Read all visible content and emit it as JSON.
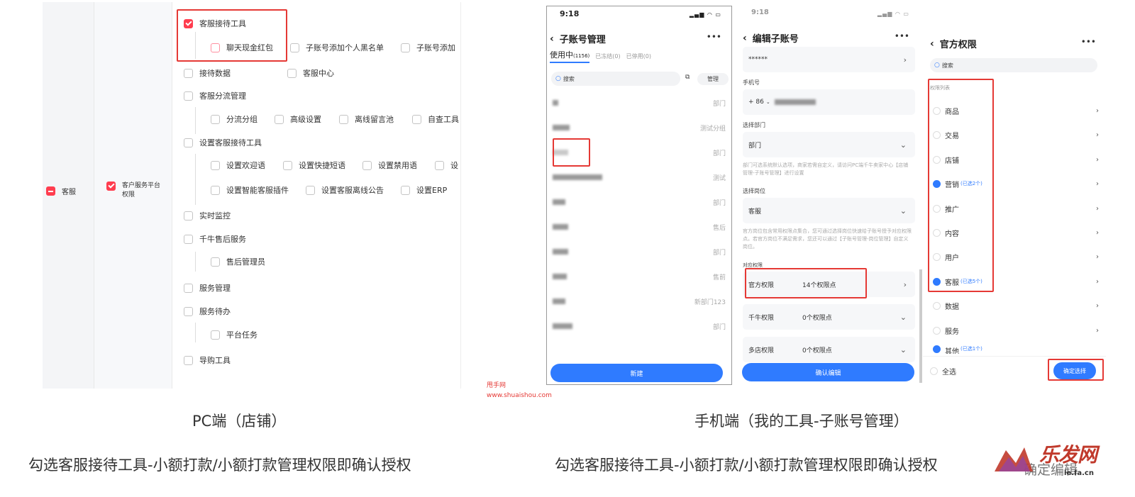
{
  "pc": {
    "level1": "客服",
    "level2": "客户服务平台权限",
    "items": {
      "kefu_tool": "客服接待工具",
      "cash_hongbao": "聊天现金红包",
      "sub_blacklist": "子账号添加个人黑名单",
      "sub_add": "子账号添加",
      "reception_data": "接待数据",
      "service_center": "客服中心",
      "diversion_mgmt": "客服分流管理",
      "diversion_group": "分流分组",
      "advanced_settings": "高级设置",
      "offline_msg": "离线留言池",
      "self_check": "自查工具",
      "set_tools": "设置客服接待工具",
      "welcome": "设置欢迎语",
      "quick_reply": "设置快捷短语",
      "forbidden_words": "设置禁用语",
      "set_more": "设",
      "plugin": "设置智能客服插件",
      "offline_notice": "设置客服离线公告",
      "erp": "设置ERP",
      "realtime": "实时监控",
      "qianniu_after": "千牛售后服务",
      "after_admin": "售后管理员",
      "service_mgmt": "服务管理",
      "service_todo": "服务待办",
      "platform_task": "平台任务",
      "guide_tool": "导购工具"
    },
    "caption": "PC端（店铺）",
    "instruction": "勾选客服接待工具-小额打款/小额打款管理权限即确认授权"
  },
  "phone1": {
    "time": "9:18",
    "signal": "▂▄▆ ◠ ▭",
    "title": "子账号管理",
    "more": "•••",
    "tabs": [
      "使用中",
      "(1156)",
      "已冻结(0)",
      "已停用(0)"
    ],
    "search_placeholder": "搜索",
    "manage": "管理",
    "rows": [
      {
        "dept": "部门"
      },
      {
        "dept": "测试分组"
      },
      {
        "dept": "部门"
      },
      {
        "dept": "测试"
      },
      {
        "dept": "部门"
      },
      {
        "dept": "售后"
      },
      {
        "dept": "部门"
      },
      {
        "dept": "售前"
      },
      {
        "dept": "新部门123"
      },
      {
        "dept": "部门"
      }
    ],
    "new_button": "新建"
  },
  "phone2": {
    "time": "9:18",
    "title": "编辑子账号",
    "more": "•••",
    "password": "******",
    "phone_label": "手机号",
    "phone_prefix": "+ 86",
    "dept_label": "选择部门",
    "dept_value": "部门",
    "dept_hint": "部门可选系统默认选项，商家若需自定义，请访问PC端千牛卖家中心【店铺管理-子账号管理】进行设置",
    "post_label": "选择岗位",
    "post_value": "客服",
    "post_hint": "官方岗位包含常用权限点集合，您可通过选择岗位快速给子账号授予对应权限点。若官方岗位不满足需求，您还可以通过【子账号管理-岗位管理】自定义岗位。",
    "perm_label": "对应权限",
    "perms": [
      {
        "name": "官方权限",
        "value": "14个权限点"
      },
      {
        "name": "千牛权限",
        "value": "0个权限点"
      },
      {
        "name": "多店权限",
        "value": "0个权限点"
      }
    ],
    "confirm_button": "确认编辑"
  },
  "phone3": {
    "title": "官方权限",
    "more": "•••",
    "search_placeholder": "搜索",
    "list_label": "权限列表",
    "perms": [
      {
        "name": "商品",
        "sub": ""
      },
      {
        "name": "交易",
        "sub": ""
      },
      {
        "name": "店铺",
        "sub": ""
      },
      {
        "name": "营销",
        "sub": "(已选2个)"
      },
      {
        "name": "推广",
        "sub": ""
      },
      {
        "name": "内容",
        "sub": ""
      },
      {
        "name": "用户",
        "sub": ""
      },
      {
        "name": "客服",
        "sub": "(已选5个)"
      },
      {
        "name": "数据",
        "sub": ""
      },
      {
        "name": "服务",
        "sub": ""
      },
      {
        "name": "其他",
        "sub": "(已选1个)"
      }
    ],
    "select_all": "全选",
    "confirm_select": "确定选择"
  },
  "mobile": {
    "caption": "手机端（我的工具-子账号管理）",
    "instruction": "勾选客服接待工具-小额打款/小额打款管理权限即确认授权",
    "overlay": "确定编辑"
  },
  "watermark": {
    "line1": "甩手网",
    "line2": "www.shuaishou.com",
    "logo": "乐发网",
    "logo_sub": "le.fa.cn"
  },
  "colors": {
    "red": "#ff3d4f",
    "blue": "#2f7bff",
    "highlight": "#e53935"
  }
}
